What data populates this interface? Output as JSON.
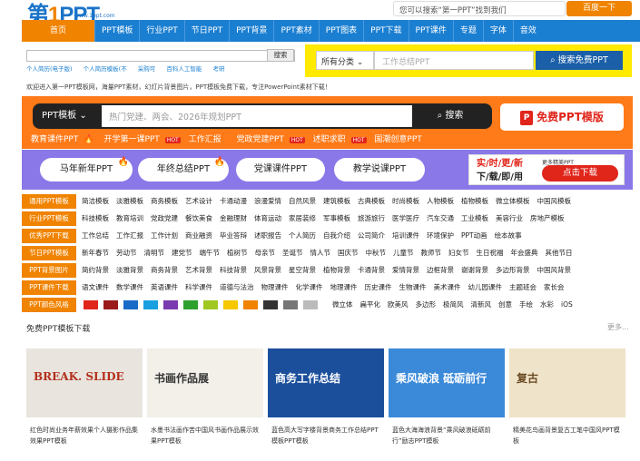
{
  "header": {
    "logo": "第1PPT",
    "logo_url": "www.1ppt.com",
    "search_placeholder": "您可以搜索“第一PPT”找到我们",
    "search_button": "百度一下"
  },
  "nav": {
    "home": "首页",
    "items": [
      "PPT模板",
      "行业PPT",
      "节日PPT",
      "PPT背景",
      "PPT素材",
      "PPT图表",
      "PPT下载",
      "PPT课件",
      "专题",
      "字体",
      "音效"
    ]
  },
  "quick": {
    "button": "搜索",
    "hot": [
      "个人简历(电子版)",
      "个人简历模板(不",
      "采购可",
      "百科人工智能",
      "考研"
    ]
  },
  "filter": {
    "select": "所有分类",
    "placeholder": "工作总结PPT",
    "button": "搜索免费PPT"
  },
  "welcome": "欢迎进入第一PPT模板网，海量PPT素材，幻灯片背景图片，PPT模板免费下载，专注PowerPoint素材下载！",
  "banner": {
    "select": "PPT模板",
    "placeholder": "热门党建、两会、2026年规划PPT",
    "button": "搜索",
    "free": "免费PPT模版",
    "tags": [
      "教育课件PPT",
      "开学第一课PPT",
      "工作汇报",
      "党政党建PPT",
      "述职求职",
      "国潮创意PPT"
    ],
    "hot": "HOT"
  },
  "pills": [
    "马年新年PPT",
    "年终总结PPT",
    "党课课件PPT",
    "教学说课PPT"
  ],
  "ad": {
    "line1": "实/时/更/新",
    "line2": "下/载/即/用",
    "small": "更多精美PPT",
    "button": "点击下载"
  },
  "categories": [
    {
      "label": "通用PPT模板",
      "items": [
        "简洁模板",
        "淡雅模板",
        "商务模板",
        "艺术设计",
        "卡通动漫",
        "浪漫爱情",
        "自然风景",
        "建筑模板",
        "古典模板",
        "时尚模板",
        "人物模板",
        "植物模板",
        "微立体模板",
        "中国风模板"
      ]
    },
    {
      "label": "行业PPT模板",
      "items": [
        "科技模板",
        "教育培训",
        "党政党建",
        "餐饮美食",
        "金融理财",
        "体育运动",
        "家居装修",
        "军事模板",
        "旅游旅行",
        "医学医疗",
        "汽车交通",
        "工业模板",
        "美容行业",
        "房地产模板"
      ]
    },
    {
      "label": "优秀PPT下载",
      "items": [
        "工作总结",
        "工作汇报",
        "工作计划",
        "商业融资",
        "毕业答辩",
        "述职报告",
        "个人简历",
        "自我介绍",
        "公司简介",
        "培训课件",
        "环境保护",
        "PPT动画",
        "绘本故事"
      ]
    },
    {
      "label": "节日PPT模板",
      "items": [
        "新年春节",
        "劳动节",
        "清明节",
        "建党节",
        "端午节",
        "植树节",
        "母亲节",
        "圣诞节",
        "情人节",
        "国庆节",
        "中秋节",
        "儿童节",
        "教师节",
        "妇女节",
        "生日祝福",
        "年会盛典",
        "其他节日"
      ]
    },
    {
      "label": "PPT背景图片",
      "items": [
        "简约背景",
        "淡雅背景",
        "商务背景",
        "艺术背景",
        "科技背景",
        "风景背景",
        "星空背景",
        "植物背景",
        "卡通背景",
        "爱情背景",
        "边框背景",
        "谢谢背景",
        "多边形背景",
        "中国风背景"
      ]
    },
    {
      "label": "PPT课件下载",
      "items": [
        "语文课件",
        "数学课件",
        "英语课件",
        "科学课件",
        "道德与法治",
        "物理课件",
        "化学课件",
        "地理课件",
        "历史课件",
        "生物课件",
        "美术课件",
        "幼儿园课件",
        "主题班会",
        "家长会"
      ]
    },
    {
      "label": "PPT颜色风格",
      "items": [
        "微立体",
        "扁平化",
        "欧美风",
        "多边形",
        "极简风",
        "清新风",
        "创意",
        "手绘",
        "水彩",
        "iOS"
      ]
    }
  ],
  "swatches": [
    "#e0251b",
    "#9b1b1b",
    "#1a6ac8",
    "#18a0e0",
    "#7a3ab0",
    "#2da02d",
    "#a0c820",
    "#f5c800",
    "#f08300",
    "#333333",
    "#777777",
    "#bbbbbb"
  ],
  "bottom": {
    "title": "免费PPT模板下载",
    "more": "更多...",
    "cards": [
      {
        "text": "红色时尚业务年薪效果个人摄影作品集效果PPT模板",
        "thumb_title": "BREAK. SLIDE",
        "bg": "#e9e4de",
        "accent": "#b3301c"
      },
      {
        "text": "水墨书法画作苦中国风书画作品展示效果PPT模板",
        "thumb_title": "书画作品展",
        "bg": "#f3f0ea",
        "accent": "#333333"
      },
      {
        "text": "蓝色高大写字楼背景商务工作总结PPT模板PPT模板",
        "thumb_title": "商务工作总结",
        "bg": "#1b4f9c",
        "accent": "#ffffff"
      },
      {
        "text": "蓝色大海海浪背景“乘风破浪砥砺前行”励志PPT模板",
        "thumb_title": "乘风破浪 砥砺前行",
        "bg": "#3b8ad9",
        "accent": "#ffffff"
      },
      {
        "text": "精美花鸟画背景复古工笔中国风PPT模板",
        "thumb_title": "复古",
        "bg": "#efe3c9",
        "accent": "#6a4a22"
      }
    ]
  }
}
